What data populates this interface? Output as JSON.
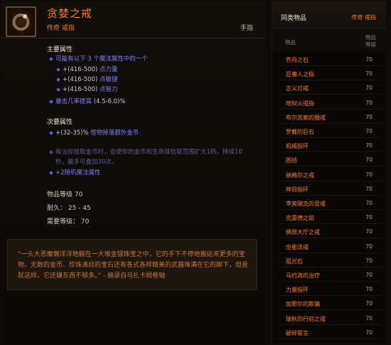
{
  "item": {
    "name": "贪婪之戒",
    "quality_type": "传奇 戒指",
    "slot": "手指",
    "icon": "ring-icon",
    "name_color": "#ff7d1e"
  },
  "primary": {
    "title": "主要属性",
    "random_header": "可能有以下 3 个魔法属性中的一个",
    "options": [
      {
        "range": "+(416-500)",
        "stat": "点力量"
      },
      {
        "range": "+(416-500)",
        "stat": "点敏捷"
      },
      {
        "range": "+(416-500)",
        "stat": "点智力"
      }
    ],
    "crit": {
      "label": "暴击几率提高",
      "range": "(4.5-6.0)%"
    }
  },
  "secondary": {
    "title": "次要属性",
    "gold": {
      "range": "+(32-35)%",
      "label": "怪物掉落额外金币"
    },
    "legendary_line1": "每当你拾取金币时，会使你的金币和生命球拾取范围扩大1码，持续10",
    "legendary_line2": "秒，最多可叠加30次。",
    "random": "+2随机魔法属性"
  },
  "stats": {
    "item_level": "物品等级 70",
    "durability": "耐久： 25 - 45",
    "required_level": "需要等级： 70"
  },
  "flavor": {
    "line1": "“一头大恶魔懒洋洋地躺在一大堆金银珠宝之中，它的手下不停地搬运来更多的宝",
    "line2": "物。无数的金币、珍珠滴目的宝石还有各式各样精美的武器堆满在它的脚下，但是",
    "line3": "就这样，它还嫌东西不够多。” - 摘录自马扎卡姆卷轴"
  },
  "sidebar": {
    "title": "同类物品",
    "type": "传奇 戒指",
    "col_name": "物品",
    "col_level_1": "物品",
    "col_level_2": "等级",
    "items": [
      {
        "name": "乔丹之石",
        "level": "70"
      },
      {
        "name": "巨魔人之指",
        "level": "70"
      },
      {
        "name": "正义灯戒",
        "level": "70"
      },
      {
        "name": "地狱火戒指",
        "level": "70"
      },
      {
        "name": "布尔凯索的婚戒",
        "level": "70"
      },
      {
        "name": "罗戴的巨石",
        "level": "70"
      },
      {
        "name": "机械指环",
        "level": "70"
      },
      {
        "name": "困结",
        "level": "70"
      },
      {
        "name": "纳格尔之戒",
        "level": "70"
      },
      {
        "name": "神目指环",
        "level": "70"
      },
      {
        "name": "李奥瑞克的显戒",
        "level": "70"
      },
      {
        "name": "克雷德之焰",
        "level": "70"
      },
      {
        "name": "佛很大厅之戒",
        "level": "70"
      },
      {
        "name": "全能法戒",
        "level": "70"
      },
      {
        "name": "孤光石",
        "level": "70"
      },
      {
        "name": "马约滴的治疗",
        "level": "70"
      },
      {
        "name": "力量指环",
        "level": "70"
      },
      {
        "name": "加那尔的欺骗",
        "level": "70"
      },
      {
        "name": "瑞秋的行窃之戒",
        "level": "70"
      },
      {
        "name": "破碎誓言",
        "level": "70"
      }
    ]
  }
}
